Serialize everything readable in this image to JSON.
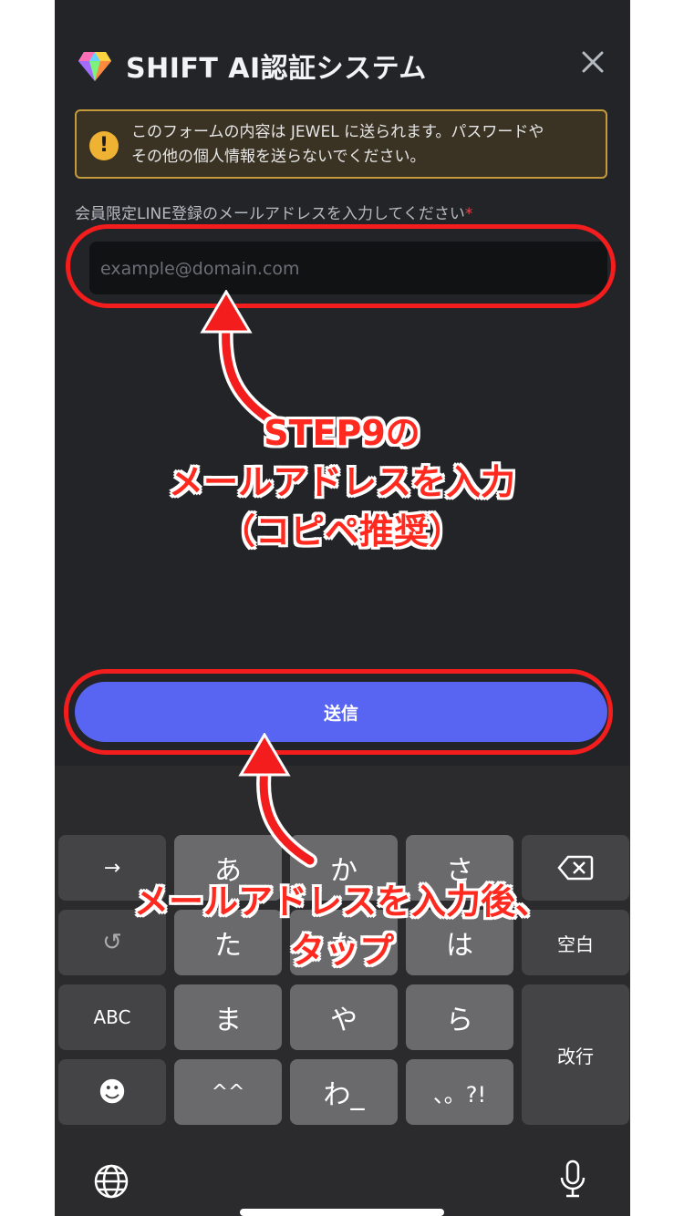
{
  "header": {
    "title": "SHIFT AI認証システム",
    "gem_icon": "gem-icon",
    "close_icon": "close-icon"
  },
  "warning": {
    "icon": "!",
    "text_line1": "このフォームの内容は JEWEL に送られます。パスワードや",
    "text_line2": "その他の個人情報を送らないでください。",
    "accent_color": "#c49a3b"
  },
  "form": {
    "label": "会員限定LINE登録のメールアドレスを入力してください",
    "required_mark": "*",
    "email_placeholder": "example@domain.com",
    "submit_label": "送信",
    "submit_color": "#5865f2"
  },
  "annotations": {
    "step_line1": "STEP9の",
    "step_line2": "メールアドレスを入力",
    "step_line3": "（コピペ推奨）",
    "tap_line1": "メールアドレスを入力後、",
    "tap_line2": "タップ",
    "highlight_color": "#f31d1d"
  },
  "keyboard": {
    "row1": [
      "→",
      "あ",
      "か",
      "さ",
      "⌫"
    ],
    "row2": [
      "↺",
      "た",
      "な",
      "は",
      "空白"
    ],
    "row3": [
      "ABC",
      "ま",
      "や",
      "ら"
    ],
    "row4": [
      "☻",
      "^^",
      "わ_",
      "、。?!"
    ],
    "enter": "改行",
    "globe_icon": "globe-icon",
    "mic_icon": "microphone-icon"
  }
}
